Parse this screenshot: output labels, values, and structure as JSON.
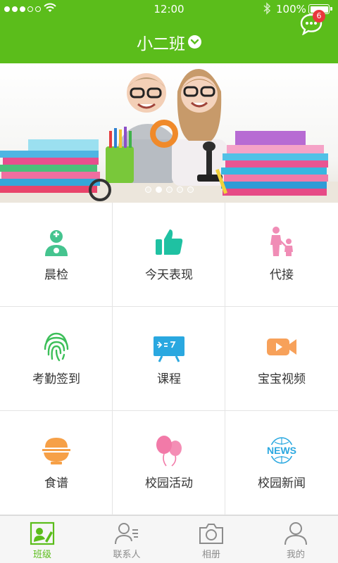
{
  "status_bar": {
    "time": "12:00",
    "battery_percent": "100%",
    "signal_strength_bars": 3
  },
  "nav": {
    "title": "小二班",
    "message_badge": "6"
  },
  "banner": {
    "slide_count": 5,
    "active_slide": 2
  },
  "grid": [
    {
      "label": "晨检",
      "icon": "doctor-icon",
      "color": "#45c48f"
    },
    {
      "label": "今天表现",
      "icon": "thumbs-up-icon",
      "color": "#1fc1a2"
    },
    {
      "label": "代接",
      "icon": "parent-child-icon",
      "color": "#f08db6"
    },
    {
      "label": "考勤签到",
      "icon": "fingerprint-icon",
      "color": "#3cbf59"
    },
    {
      "label": "课程",
      "icon": "blackboard-icon",
      "color": "#2aa8e0"
    },
    {
      "label": "宝宝视频",
      "icon": "video-camera-icon",
      "color": "#f7a15a"
    },
    {
      "label": "食谱",
      "icon": "rice-bowl-icon",
      "color": "#f6a047"
    },
    {
      "label": "校园活动",
      "icon": "balloons-icon",
      "color": "#f27aa8"
    },
    {
      "label": "校园新闻",
      "icon": "news-globe-icon",
      "color": "#2aa8e0"
    }
  ],
  "tabs": [
    {
      "label": "班级",
      "icon": "class-icon",
      "active": true
    },
    {
      "label": "联系人",
      "icon": "contacts-icon",
      "active": false
    },
    {
      "label": "相册",
      "icon": "camera-icon",
      "active": false
    },
    {
      "label": "我的",
      "icon": "profile-icon",
      "active": false
    }
  ],
  "colors": {
    "brand_green": "#5bbd1b",
    "badge_red": "#e8383d",
    "tab_inactive": "#8c8c8c"
  }
}
